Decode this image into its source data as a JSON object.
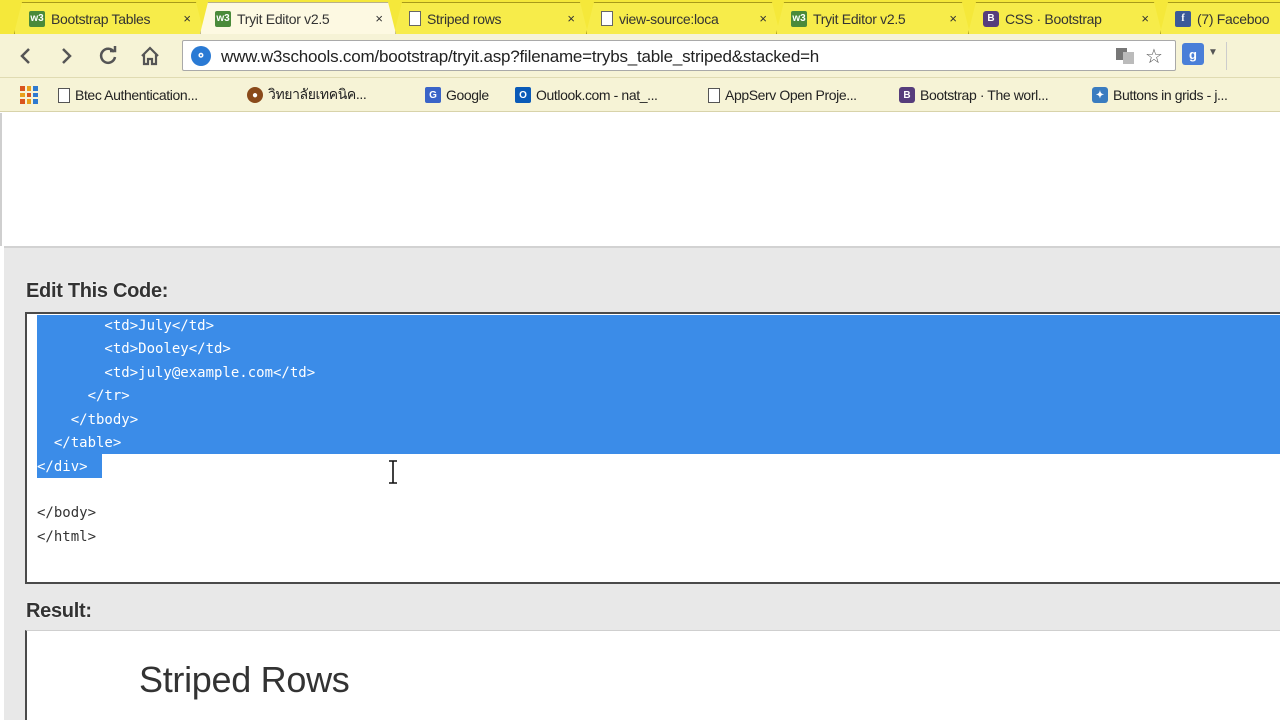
{
  "browser": {
    "tabs": [
      {
        "label": "Bootstrap Tables",
        "icon": "w3schools-icon"
      },
      {
        "label": "Tryit Editor v2.5",
        "icon": "w3schools-icon",
        "active": true
      },
      {
        "label": "Striped rows",
        "icon": "page-icon"
      },
      {
        "label": "view-source:loca",
        "icon": "page-icon"
      },
      {
        "label": "Tryit Editor v2.5",
        "icon": "w3schools-icon"
      },
      {
        "label": "CSS · Bootstrap",
        "icon": "bootstrap-icon"
      },
      {
        "label": "(7) Faceboo",
        "icon": "facebook-icon"
      }
    ],
    "close_glyph": "×",
    "url": "www.w3schools.com/bootstrap/tryit.asp?filename=trybs_table_striped&stacked=h",
    "bookmarks": [
      {
        "label": "Btec Authentication...",
        "icon": "page-icon"
      },
      {
        "label": "วิทยาลัยเทคนิค...",
        "icon": "site-icon"
      },
      {
        "label": "Google",
        "icon": "google-icon"
      },
      {
        "label": "Outlook.com - nat_...",
        "icon": "outlook-icon"
      },
      {
        "label": "AppServ Open Proje...",
        "icon": "page-icon"
      },
      {
        "label": "Bootstrap · The worl...",
        "icon": "bootstrap-icon"
      },
      {
        "label": "Buttons in grids - j...",
        "icon": "puzzle-icon"
      }
    ]
  },
  "editor": {
    "edit_label": "Edit This Code:",
    "code_lines": [
      "        <td>July</td>",
      "        <td>Dooley</td>",
      "        <td>july@example.com</td>",
      "      </tr>",
      "    </tbody>",
      "  </table>",
      "</div>",
      "",
      "</body>",
      "</html>"
    ],
    "result_label": "Result:",
    "result_heading": "Striped Rows"
  },
  "colors": {
    "tab_strip": "#f5e83a",
    "selection": "#3b8ce8"
  }
}
